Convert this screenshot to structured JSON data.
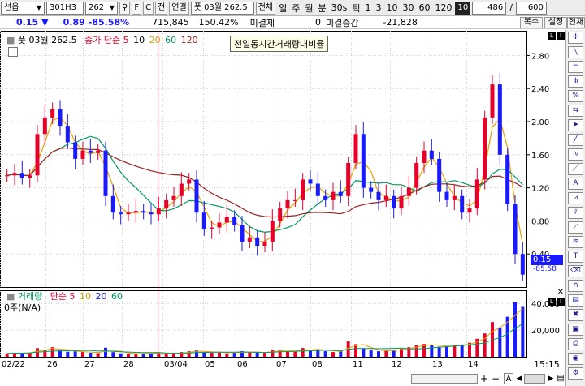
{
  "toolbar": {
    "market": "선옵",
    "code": "301H3",
    "strike": "262",
    "btn_f": "F",
    "btn_c": "C",
    "btn_jeon": "전",
    "link_btn": "연결",
    "product_label": "풋 03월 262.5",
    "all_btn": "전체",
    "periods": [
      "일",
      "주",
      "월",
      "분",
      "30s",
      "틱"
    ],
    "intervals": [
      "1",
      "3",
      "10",
      "30",
      "60",
      "120"
    ],
    "count_selected": "10",
    "count_value": "486",
    "total_value": "600"
  },
  "tabs": [
    "복수",
    "설정",
    "현재"
  ],
  "info": {
    "change_value": "0.15",
    "change_arrow": "▼",
    "change_abs": "0.89",
    "change_pct": "-85.58%",
    "volume": "715,845",
    "vol_ratio": "150.42%",
    "unsettled_label": "미결제",
    "unsettled_value": "0",
    "unsettled_change_label": "미결증감",
    "unsettled_change_value": "-21,828"
  },
  "main_legend": {
    "series_label": "풋 03월 262.5",
    "ma_label": "종가 단순",
    "ma_periods": [
      "5",
      "10",
      "20",
      "60",
      "120"
    ],
    "title_box": "전일동시간거래량대비율"
  },
  "volume_legend": {
    "label": "거래량",
    "ma_label": "단순",
    "ma_periods": [
      "5",
      "10",
      "20",
      "60"
    ],
    "unit": "0주(N/A)"
  },
  "colors": {
    "ma5": "#e8002a",
    "ma10": "#e8a000",
    "ma20": "#c8a000",
    "ma60": "#009960",
    "ma120": "#9c2020",
    "candle_up": "#e8002a",
    "candle_down": "#1a1aff"
  },
  "chart_data": [
    {
      "type": "candlestick",
      "ylim": [
        0.0,
        3.0
      ],
      "y_ticks": [
        "2.80",
        "2.40",
        "2.00",
        "1.60",
        "1.20",
        "0.80",
        "0.40"
      ],
      "x_ticks": [
        "02/22",
        "26",
        "27",
        "28",
        "03/04",
        "05",
        "06",
        "07",
        "08",
        "11",
        "12",
        "13",
        "14"
      ],
      "last_price": "0.15",
      "last_change": "-85.58",
      "close_series": [
        1.35,
        1.38,
        1.32,
        1.35,
        1.85,
        2.05,
        2.15,
        1.95,
        1.75,
        1.55,
        1.65,
        1.62,
        1.65,
        1.1,
        0.9,
        0.88,
        0.9,
        0.92,
        0.9,
        0.88,
        0.95,
        1.05,
        1.1,
        1.25,
        1.3,
        0.9,
        0.7,
        0.72,
        0.78,
        0.85,
        0.75,
        0.55,
        0.6,
        0.5,
        0.55,
        0.8,
        0.95,
        1.05,
        1.05,
        1.3,
        1.25,
        1.1,
        1.05,
        1.15,
        1.1,
        1.5,
        1.85,
        1.2,
        1.15,
        1.05,
        1.1,
        0.95,
        1.1,
        1.2,
        1.5,
        1.65,
        1.55,
        1.15,
        1.05,
        1.1,
        0.9,
        0.95,
        1.3,
        2.05,
        2.45,
        1.6,
        1.0,
        0.4,
        0.15
      ]
    },
    {
      "type": "bar",
      "ylim": [
        0,
        45000
      ],
      "y_ticks": [
        "40,000",
        "20,000"
      ],
      "values": [
        2500,
        3000,
        2800,
        3200,
        6500,
        5200,
        7200,
        4800,
        3800,
        4200,
        3600,
        3000,
        2800,
        6800,
        3500,
        2600,
        2400,
        2200,
        2600,
        2800,
        3200,
        2500,
        2300,
        3600,
        4200,
        4800,
        3400,
        3000,
        3800,
        2600,
        3000,
        4200,
        3600,
        3200,
        3000,
        5000,
        5400,
        4200,
        3800,
        6600,
        4800,
        5800,
        4200,
        3600,
        4200,
        11500,
        9500,
        6500,
        4800,
        4200,
        4600,
        5200,
        6000,
        7200,
        8500,
        9600,
        8600,
        7600,
        8000,
        8800,
        9200,
        10500,
        13500,
        17500,
        26000,
        22000,
        30000,
        41000,
        38000
      ]
    }
  ],
  "time_label": "15:15"
}
